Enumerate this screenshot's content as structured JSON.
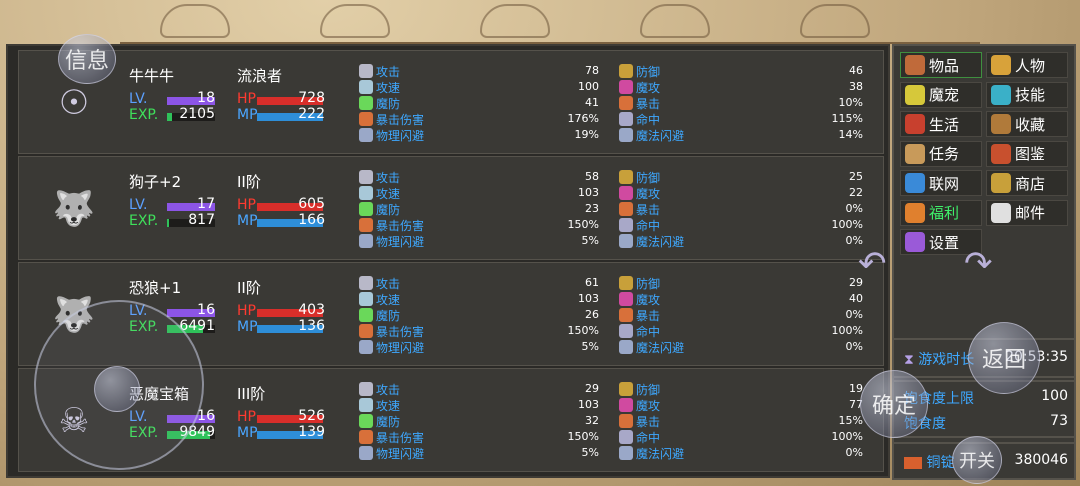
{
  "characters": [
    {
      "name": "牛牛牛",
      "class": "流浪者",
      "sprite_icon": "purple-egg-pet-icon",
      "lv_label": "LV.",
      "lv": "18",
      "exp_label": "EXP.",
      "exp": "2105",
      "exp_fraction": 0.1,
      "hp_label": "HP",
      "hp": "728",
      "mp_label": "MP",
      "mp": "222",
      "left_stats": [
        {
          "label": "攻击",
          "value": "78"
        },
        {
          "label": "攻速",
          "value": "100"
        },
        {
          "label": "魔防",
          "value": "41"
        },
        {
          "label": "暴击伤害",
          "value": "176%"
        },
        {
          "label": "物理闪避",
          "value": "19%"
        }
      ],
      "right_stats": [
        {
          "label": "防御",
          "value": "46"
        },
        {
          "label": "魔攻",
          "value": "38"
        },
        {
          "label": "暴击",
          "value": "10%"
        },
        {
          "label": "命中",
          "value": "115%"
        },
        {
          "label": "魔法闪避",
          "value": "14%"
        }
      ]
    },
    {
      "name": "狗子+2",
      "class": "II阶",
      "sprite_icon": "white-wolf-pet-icon",
      "lv_label": "LV.",
      "lv": "17",
      "exp_label": "EXP.",
      "exp": "817",
      "exp_fraction": 0.05,
      "hp_label": "HP",
      "hp": "605",
      "mp_label": "MP",
      "mp": "166",
      "left_stats": [
        {
          "label": "攻击",
          "value": "58"
        },
        {
          "label": "攻速",
          "value": "103"
        },
        {
          "label": "魔防",
          "value": "23"
        },
        {
          "label": "暴击伤害",
          "value": "150%"
        },
        {
          "label": "物理闪避",
          "value": "5%"
        }
      ],
      "right_stats": [
        {
          "label": "防御",
          "value": "25"
        },
        {
          "label": "魔攻",
          "value": "22"
        },
        {
          "label": "暴击",
          "value": "0%"
        },
        {
          "label": "命中",
          "value": "100%"
        },
        {
          "label": "魔法闪避",
          "value": "0%"
        }
      ]
    },
    {
      "name": "恐狼+1",
      "class": "II阶",
      "sprite_icon": "dire-wolf-pet-icon",
      "lv_label": "LV.",
      "lv": "16",
      "exp_label": "EXP.",
      "exp": "6491",
      "exp_fraction": 0.75,
      "hp_label": "HP",
      "hp": "403",
      "mp_label": "MP",
      "mp": "136",
      "left_stats": [
        {
          "label": "攻击",
          "value": "61"
        },
        {
          "label": "攻速",
          "value": "103"
        },
        {
          "label": "魔防",
          "value": "26"
        },
        {
          "label": "暴击伤害",
          "value": "150%"
        },
        {
          "label": "物理闪避",
          "value": "5%"
        }
      ],
      "right_stats": [
        {
          "label": "防御",
          "value": "29"
        },
        {
          "label": "魔攻",
          "value": "40"
        },
        {
          "label": "暴击",
          "value": "0%"
        },
        {
          "label": "命中",
          "value": "100%"
        },
        {
          "label": "魔法闪避",
          "value": "0%"
        }
      ]
    },
    {
      "name": "恶魔宝箱",
      "class": "III阶",
      "sprite_icon": "demon-chest-pet-icon",
      "lv_label": "LV.",
      "lv": "16",
      "exp_label": "EXP.",
      "exp": "9849",
      "exp_fraction": 0.9,
      "hp_label": "HP",
      "hp": "526",
      "mp_label": "MP",
      "mp": "139",
      "left_stats": [
        {
          "label": "攻击",
          "value": "29"
        },
        {
          "label": "攻速",
          "value": "103"
        },
        {
          "label": "魔防",
          "value": "32"
        },
        {
          "label": "暴击伤害",
          "value": "150%"
        },
        {
          "label": "物理闪避",
          "value": "5%"
        }
      ],
      "right_stats": [
        {
          "label": "防御",
          "value": "19"
        },
        {
          "label": "魔攻",
          "value": "77"
        },
        {
          "label": "暴击",
          "value": "15%"
        },
        {
          "label": "命中",
          "value": "100%"
        },
        {
          "label": "魔法闪避",
          "value": "0%"
        }
      ]
    }
  ],
  "menu": [
    {
      "label": "物品",
      "icon": "bag-icon",
      "icon_color": "#c06a3a"
    },
    {
      "label": "人物",
      "icon": "character-icon",
      "icon_color": "#d8a23a"
    },
    {
      "label": "魔宠",
      "icon": "pet-egg-icon",
      "icon_color": "#d6c83a"
    },
    {
      "label": "技能",
      "icon": "skill-icon",
      "icon_color": "#3ab0c8"
    },
    {
      "label": "生活",
      "icon": "life-icon",
      "icon_color": "#c8402e"
    },
    {
      "label": "收藏",
      "icon": "collection-icon",
      "icon_color": "#b07a3a"
    },
    {
      "label": "任务",
      "icon": "quest-scroll-icon",
      "icon_color": "#c89a5a"
    },
    {
      "label": "图鉴",
      "icon": "codex-book-icon",
      "icon_color": "#c8502e"
    },
    {
      "label": "联网",
      "icon": "network-icon",
      "icon_color": "#3a8ad8"
    },
    {
      "label": "商店",
      "icon": "shop-icon",
      "icon_color": "#c8a03a"
    },
    {
      "label": "福利",
      "icon": "gift-icon",
      "icon_color": "#e0802e"
    },
    {
      "label": "邮件",
      "icon": "mail-icon",
      "icon_color": "#e0e0e0"
    },
    {
      "label": "设置",
      "icon": "settings-gear-icon",
      "icon_color": "#9a5ad8"
    }
  ],
  "info": {
    "play_time_label": "游戏时长",
    "play_time": "20:53:35",
    "satiety_max_label": "饱食度上限",
    "satiety_max": "100",
    "satiety_label": "饱食度",
    "satiety": "73",
    "copper_label": "铜锭",
    "copper": "380046"
  },
  "overlay": {
    "info_btn": "信息",
    "back_btn": "返回",
    "confirm_btn": "确定",
    "switch_btn": "开关"
  },
  "colors": {
    "stat_label": "#3ea8ff",
    "hp": "#ff3a30",
    "mp": "#4aa6ff",
    "lv": "#5ba0ff",
    "exp": "#3fe05b",
    "active_menu_label": "#3ff06a"
  }
}
